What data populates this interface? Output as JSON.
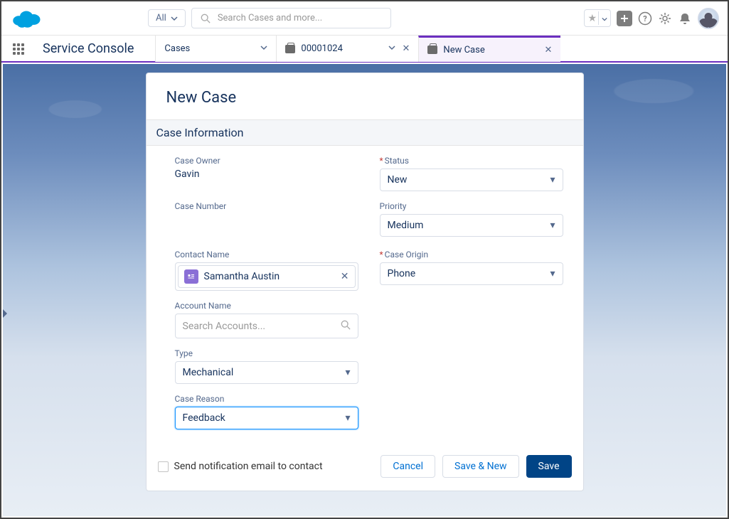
{
  "header": {
    "all_label": "All",
    "search_placeholder": "Search Cases and more..."
  },
  "nav": {
    "app_name": "Service Console",
    "tab_cases": "Cases",
    "tab_record": "00001024",
    "tab_newcase": "New Case"
  },
  "form": {
    "title": "New Case",
    "section": "Case Information",
    "labels": {
      "case_owner": "Case Owner",
      "case_number": "Case Number",
      "contact_name": "Contact Name",
      "account_name": "Account Name",
      "type": "Type",
      "case_reason": "Case Reason",
      "status": "Status",
      "priority": "Priority",
      "case_origin": "Case Origin"
    },
    "values": {
      "case_owner": "Gavin",
      "case_number": "",
      "contact_name": "Samantha Austin",
      "account_placeholder": "Search Accounts...",
      "type": "Mechanical",
      "case_reason": "Feedback",
      "status": "New",
      "priority": "Medium",
      "case_origin": "Phone"
    }
  },
  "footer": {
    "notify_label": "Send notification email to contact",
    "cancel": "Cancel",
    "save_new": "Save & New",
    "save": "Save"
  }
}
